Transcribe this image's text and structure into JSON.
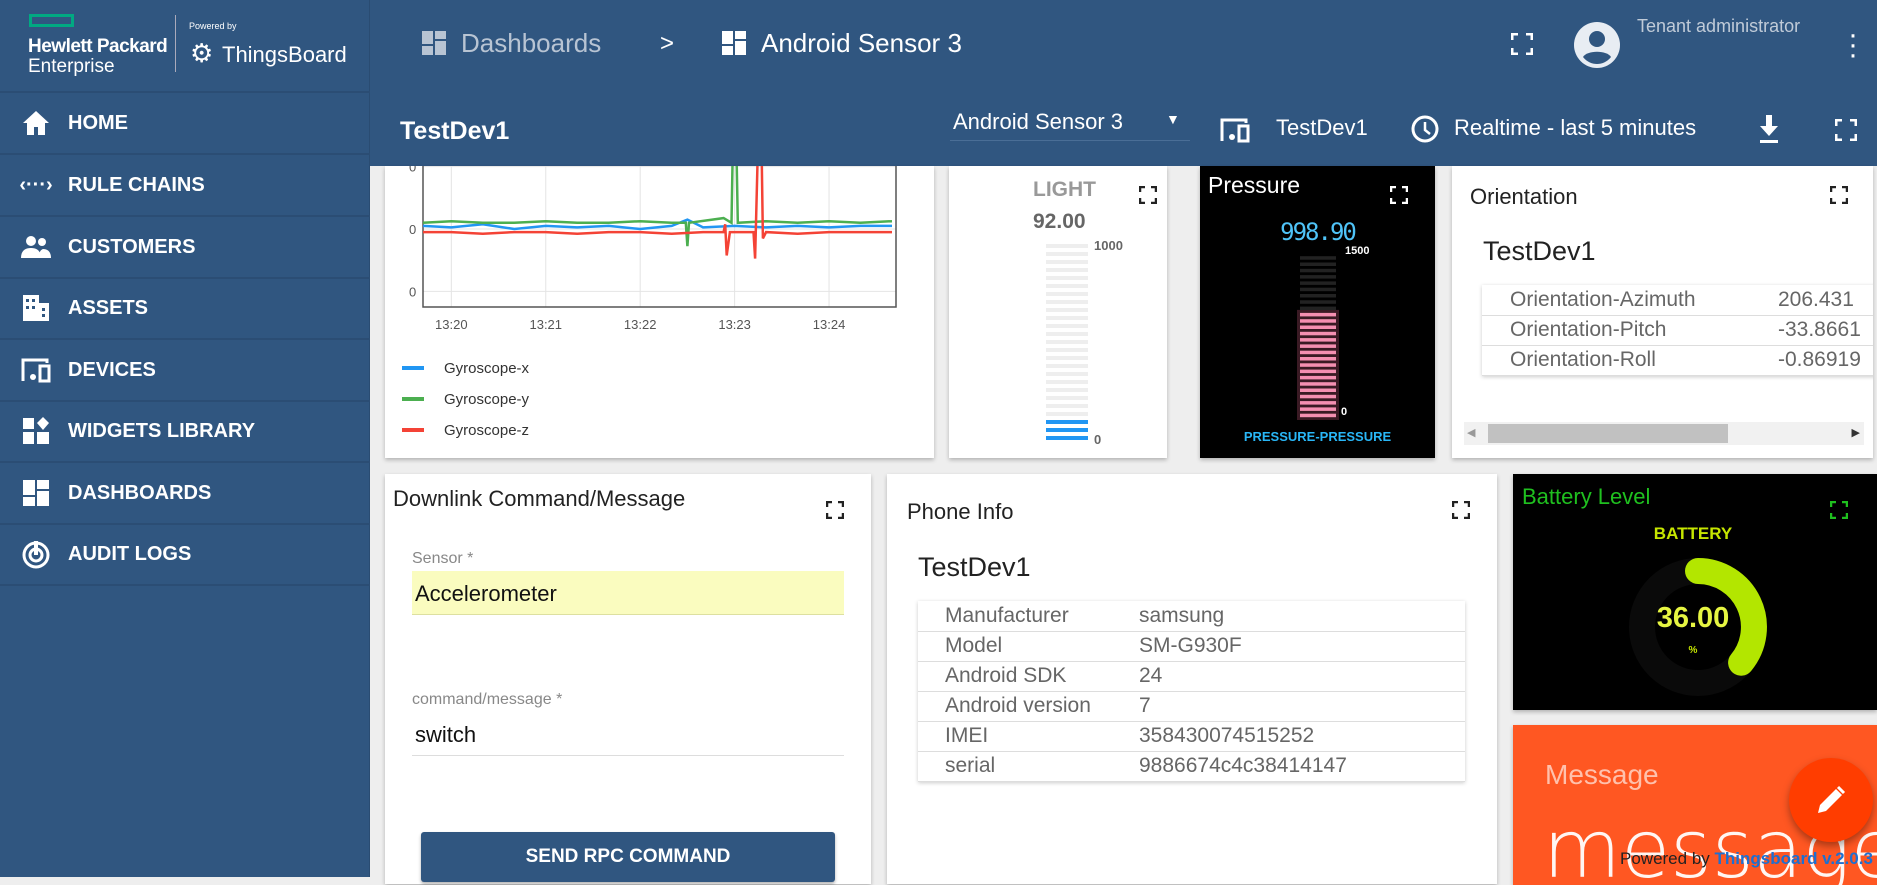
{
  "brand": {
    "hpe_line1": "Hewlett Packard",
    "hpe_line2": "Enterprise",
    "powered_by": "Powered by",
    "thingsboard": "ThingsBoard",
    "accent": "#01a982"
  },
  "sidebar": {
    "items": [
      {
        "label": "HOME",
        "icon": "home-icon"
      },
      {
        "label": "RULE CHAINS",
        "icon": "rule-chains-icon"
      },
      {
        "label": "CUSTOMERS",
        "icon": "customers-icon"
      },
      {
        "label": "ASSETS",
        "icon": "assets-icon"
      },
      {
        "label": "DEVICES",
        "icon": "devices-icon"
      },
      {
        "label": "WIDGETS LIBRARY",
        "icon": "widgets-icon"
      },
      {
        "label": "DASHBOARDS",
        "icon": "dashboards-icon"
      },
      {
        "label": "AUDIT LOGS",
        "icon": "audit-logs-icon"
      }
    ]
  },
  "header": {
    "breadcrumb": [
      {
        "label": "Dashboards"
      },
      {
        "label": "Android Sensor 3"
      }
    ],
    "separator": ">",
    "user": "Tenant administrator"
  },
  "toolbar": {
    "title": "TestDev1",
    "dashboard_select": "Android Sensor 3",
    "entity": "TestDev1",
    "timewindow": "Realtime - last 5 minutes"
  },
  "chart_data": {
    "type": "line",
    "xlabel": "",
    "ylabel": "",
    "x_ticks": [
      "13:20",
      "13:21",
      "13:22",
      "13:23",
      "13:24"
    ],
    "y_tick_labels": [
      "0",
      "0",
      "0"
    ],
    "ylim": [
      -0.5,
      0.5
    ],
    "grid": true,
    "legend": "bottom-left",
    "series": [
      {
        "name": "Gyroscope-x",
        "color": "#2196f3",
        "points": [
          [
            "13:19:42",
            0.02
          ],
          [
            "13:20:00",
            0.01
          ],
          [
            "13:20:20",
            0.03
          ],
          [
            "13:20:40",
            0.0
          ],
          [
            "13:21:00",
            0.02
          ],
          [
            "13:21:20",
            0.01
          ],
          [
            "13:21:40",
            0.02
          ],
          [
            "13:22:00",
            0.0
          ],
          [
            "13:22:20",
            0.02
          ],
          [
            "13:22:30",
            0.06
          ],
          [
            "13:22:40",
            0.01
          ],
          [
            "13:23:00",
            0.02
          ],
          [
            "13:23:20",
            0.01
          ],
          [
            "13:23:40",
            0.02
          ],
          [
            "13:24:00",
            0.01
          ],
          [
            "13:24:20",
            0.02
          ],
          [
            "13:24:40",
            0.02
          ]
        ]
      },
      {
        "name": "Gyroscope-y",
        "color": "#4caf50",
        "points": [
          [
            "13:19:42",
            0.04
          ],
          [
            "13:20:00",
            0.05
          ],
          [
            "13:20:20",
            0.04
          ],
          [
            "13:20:40",
            0.04
          ],
          [
            "13:21:00",
            0.05
          ],
          [
            "13:21:20",
            0.04
          ],
          [
            "13:21:40",
            0.04
          ],
          [
            "13:22:00",
            0.05
          ],
          [
            "13:22:20",
            0.04
          ],
          [
            "13:22:29",
            0.04
          ],
          [
            "13:22:30",
            -0.11
          ],
          [
            "13:22:31",
            0.04
          ],
          [
            "13:22:53",
            0.07
          ],
          [
            "13:22:58",
            0.04
          ],
          [
            "13:22:59",
            0.6
          ],
          [
            "13:23:01",
            0.6
          ],
          [
            "13:23:02",
            0.04
          ],
          [
            "13:23:20",
            0.05
          ],
          [
            "13:23:40",
            0.04
          ],
          [
            "13:24:00",
            0.05
          ],
          [
            "13:24:20",
            0.04
          ],
          [
            "13:24:40",
            0.05
          ]
        ]
      },
      {
        "name": "Gyroscope-z",
        "color": "#f44336",
        "points": [
          [
            "13:19:42",
            -0.02
          ],
          [
            "13:20:00",
            -0.02
          ],
          [
            "13:20:20",
            -0.03
          ],
          [
            "13:20:40",
            -0.02
          ],
          [
            "13:21:00",
            -0.02
          ],
          [
            "13:21:20",
            -0.03
          ],
          [
            "13:21:40",
            -0.02
          ],
          [
            "13:22:00",
            -0.02
          ],
          [
            "13:22:20",
            -0.03
          ],
          [
            "13:22:40",
            -0.02
          ],
          [
            "13:22:53",
            -0.02
          ],
          [
            "13:22:54",
            0.03
          ],
          [
            "13:22:55",
            -0.17
          ],
          [
            "13:22:57",
            -0.02
          ],
          [
            "13:23:12",
            -0.02
          ],
          [
            "13:23:13",
            -0.19
          ],
          [
            "13:23:15",
            0.6
          ],
          [
            "13:23:17",
            0.6
          ],
          [
            "13:23:18",
            -0.06
          ],
          [
            "13:23:20",
            -0.02
          ],
          [
            "13:23:40",
            -0.03
          ],
          [
            "13:24:00",
            -0.02
          ],
          [
            "13:24:20",
            -0.02
          ],
          [
            "13:24:40",
            -0.02
          ]
        ]
      }
    ]
  },
  "light": {
    "label": "LIGHT",
    "value": "92.00",
    "max": "1000",
    "min": "0",
    "fraction": 0.092,
    "color": "#2196f3"
  },
  "pressure": {
    "title": "Pressure",
    "value": "998.90",
    "max": "1500",
    "min": "0",
    "fraction": 0.666,
    "label": "PRESSURE-PRESSURE"
  },
  "orientation": {
    "title": "Orientation",
    "entity": "TestDev1",
    "rows": [
      {
        "key": "Orientation-Azimuth",
        "value": "206.431"
      },
      {
        "key": "Orientation-Pitch",
        "value": "-33.8661"
      },
      {
        "key": "Orientation-Roll",
        "value": "-0.86919"
      }
    ]
  },
  "downlink": {
    "title": "Downlink Command/Message",
    "sensor_label": "Sensor *",
    "sensor_value": "Accelerometer",
    "command_label": "command/message *",
    "command_value": "switch",
    "button": "SEND RPC COMMAND"
  },
  "phone": {
    "title": "Phone Info",
    "entity": "TestDev1",
    "rows": [
      {
        "key": "Manufacturer",
        "value": "samsung"
      },
      {
        "key": "Model",
        "value": "SM-G930F"
      },
      {
        "key": "Android SDK",
        "value": "24"
      },
      {
        "key": "Android version",
        "value": "7"
      },
      {
        "key": "IMEI",
        "value": "358430074515252"
      },
      {
        "key": "serial",
        "value": "9886674c4c38414147"
      }
    ]
  },
  "battery": {
    "title": "Battery Level",
    "label": "BATTERY",
    "value": "36.00",
    "unit": "%",
    "percent": 36,
    "color": "#b3e600"
  },
  "message": {
    "title": "Message",
    "value": "message"
  },
  "footer": {
    "powered": "Powered by",
    "link": "Thingsboard v.2.0.3"
  }
}
